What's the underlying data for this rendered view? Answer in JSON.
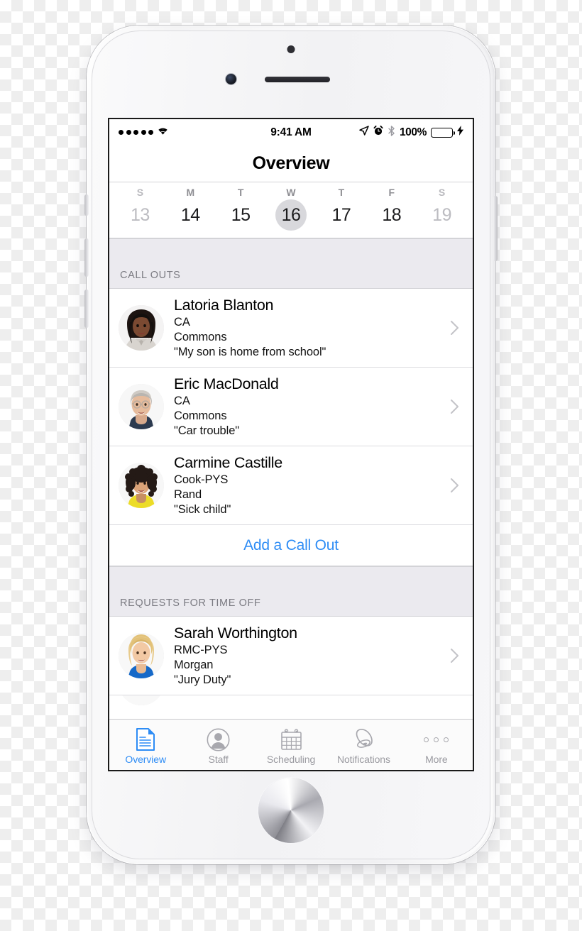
{
  "status_bar": {
    "signal_dots": 5,
    "wifi_icon": "wifi-icon",
    "time": "9:41 AM",
    "location_icon": "location-arrow-icon",
    "alarm_icon": "alarm-clock-icon",
    "bluetooth_icon": "bluetooth-icon",
    "battery_percent": "100%",
    "battery_charging": true,
    "battery_color": "#4cd964"
  },
  "nav": {
    "title": "Overview"
  },
  "week_strip": {
    "days": [
      {
        "letter": "S",
        "number": "13",
        "selected": false,
        "dimmed": true
      },
      {
        "letter": "M",
        "number": "14",
        "selected": false,
        "dimmed": false
      },
      {
        "letter": "T",
        "number": "15",
        "selected": false,
        "dimmed": false
      },
      {
        "letter": "W",
        "number": "16",
        "selected": true,
        "dimmed": false
      },
      {
        "letter": "T",
        "number": "17",
        "selected": false,
        "dimmed": false
      },
      {
        "letter": "F",
        "number": "18",
        "selected": false,
        "dimmed": false
      },
      {
        "letter": "S",
        "number": "19",
        "selected": false,
        "dimmed": true
      }
    ],
    "selected_highlight_color": "#d8d8dc"
  },
  "sections": {
    "call_outs": {
      "header": "CALL OUTS",
      "rows": [
        {
          "name": "Latoria Blanton",
          "role": "CA",
          "location": "Commons",
          "reason": "\"My son is home from school\"",
          "avatar": "avatar-latoria-blanton"
        },
        {
          "name": "Eric MacDonald",
          "role": "CA",
          "location": "Commons",
          "reason": "\"Car trouble\"",
          "avatar": "avatar-eric-macdonald"
        },
        {
          "name": "Carmine Castille",
          "role": "Cook-PYS",
          "location": "Rand",
          "reason": "\"Sick child\"",
          "avatar": "avatar-carmine-castille"
        }
      ],
      "action_label": "Add a Call Out",
      "action_color": "#2d8cf5"
    },
    "time_off": {
      "header": "REQUESTS FOR TIME OFF",
      "rows": [
        {
          "name": "Sarah Worthington",
          "role": "RMC-PYS",
          "location": "Morgan",
          "reason": "\"Jury Duty\"",
          "avatar": "avatar-sarah-worthington"
        }
      ]
    }
  },
  "tab_bar": {
    "active_color": "#2d8cf5",
    "inactive_color": "#9a9aa0",
    "tabs": [
      {
        "label": "Overview",
        "icon": "document-icon",
        "active": true
      },
      {
        "label": "Staff",
        "icon": "person-icon",
        "active": false
      },
      {
        "label": "Scheduling",
        "icon": "calendar-icon",
        "active": false
      },
      {
        "label": "Notifications",
        "icon": "bell-icon",
        "active": false
      },
      {
        "label": "More",
        "icon": "ellipsis-icon",
        "active": false
      }
    ]
  }
}
